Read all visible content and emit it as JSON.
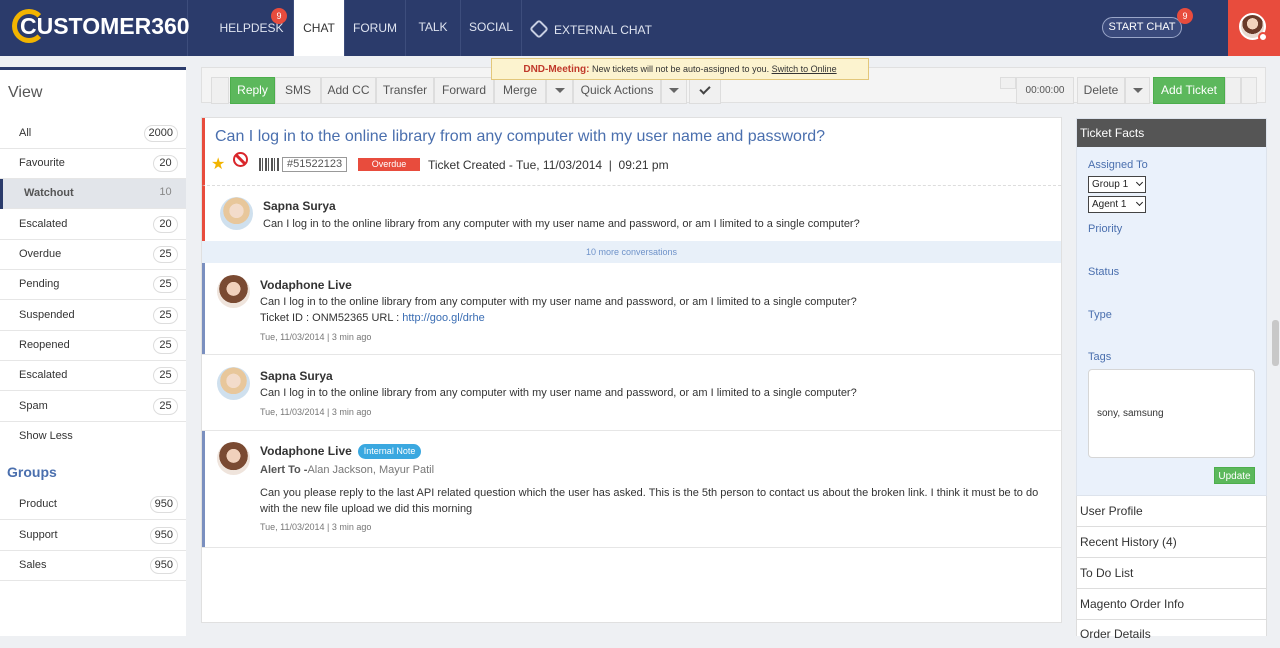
{
  "brand": {
    "name": "CUSTOMER360"
  },
  "nav": {
    "tabs": [
      {
        "label": "HELPDESK",
        "badge": "9"
      },
      {
        "label": "CHAT"
      },
      {
        "label": "FORUM"
      },
      {
        "label": "TALK"
      },
      {
        "label": "SOCIAL"
      },
      {
        "label": "EXTERNAL CHAT"
      }
    ],
    "start_chat": {
      "label": "START CHAT",
      "badge": "9"
    }
  },
  "sidebar": {
    "view_title": "View",
    "items": [
      {
        "label": "All",
        "count": "2000"
      },
      {
        "label": "Favourite",
        "count": "20"
      },
      {
        "label": "Watchout",
        "count": "10"
      },
      {
        "label": "Escalated",
        "count": "20"
      },
      {
        "label": "Overdue",
        "count": "25"
      },
      {
        "label": "Pending",
        "count": "25"
      },
      {
        "label": "Suspended",
        "count": "25"
      },
      {
        "label": "Reopened",
        "count": "25"
      },
      {
        "label": "Escalated",
        "count": "25"
      },
      {
        "label": "Spam",
        "count": "25"
      },
      {
        "label": "Show Less"
      }
    ],
    "groups_title": "Groups",
    "groups": [
      {
        "label": "Product",
        "count": "950"
      },
      {
        "label": "Support",
        "count": "950"
      },
      {
        "label": "Sales",
        "count": "950"
      }
    ]
  },
  "toolbar": {
    "reply": "Reply",
    "sms": "SMS",
    "add_cc": "Add CC",
    "transfer": "Transfer",
    "forward": "Forward",
    "merge": "Merge",
    "quick_actions": "Quick Actions",
    "timer": "00:00:00",
    "delete": "Delete",
    "add_ticket": "Add Ticket"
  },
  "dnd": {
    "label": "DND-Meeting:",
    "message": "New tickets will not be auto-assigned to you.",
    "link": "Switch to Online"
  },
  "ticket": {
    "subject": "Can I log in to the online library from any computer with my user name and password?",
    "id": "#51522123",
    "status": "Overdue",
    "created": "Ticket Created - Tue, 11/03/2014  |  09:21 pm"
  },
  "messages": [
    {
      "name": "Sapna Surya",
      "text": "Can I log in to the online library from any computer with my user name and password, or am I limited to a single computer?"
    },
    {
      "more": "10 more conversations"
    },
    {
      "name": "Vodaphone Live",
      "text": "Can I log in to the online library from any computer with my user name and password, or am I limited to a single computer?",
      "ticket_line": "Ticket ID : ONM52365 URL : ",
      "url": "http://goo.gl/drhe",
      "meta": "Tue, 11/03/2014 | 3 min ago"
    },
    {
      "name": "Sapna Surya",
      "text": "Can I log in to the online library from any computer with my user name and password, or am I limited to a single computer?",
      "meta": "Tue, 11/03/2014 | 3 min ago"
    },
    {
      "name": "Vodaphone Live",
      "badge": "Internal Note",
      "alert_label": "Alert To -",
      "alert_to": "Alan Jackson, Mayur Patil",
      "text": "Can you please reply to the last API related question which the user has asked. This is the 5th person to contact us about the broken link. I think it must be to do with the new file upload we did this morning",
      "meta": "Tue, 11/03/2014 | 3 min ago"
    }
  ],
  "facts": {
    "title": "Ticket Facts",
    "assigned_to": "Assigned To",
    "group_value": "Group 1",
    "agent_value": "Agent 1",
    "priority": "Priority",
    "status": "Status",
    "type": "Type",
    "tags": "Tags",
    "tags_value": "sony, samsung",
    "update": "Update"
  },
  "panels": [
    "User Profile",
    "Recent History (4)",
    "To Do List",
    "Magento Order Info",
    "Order Details"
  ],
  "colors": {
    "nav": "#2b3b6b",
    "accent_red": "#e84c3d",
    "green": "#5cb85c",
    "link": "#4a6fae"
  }
}
